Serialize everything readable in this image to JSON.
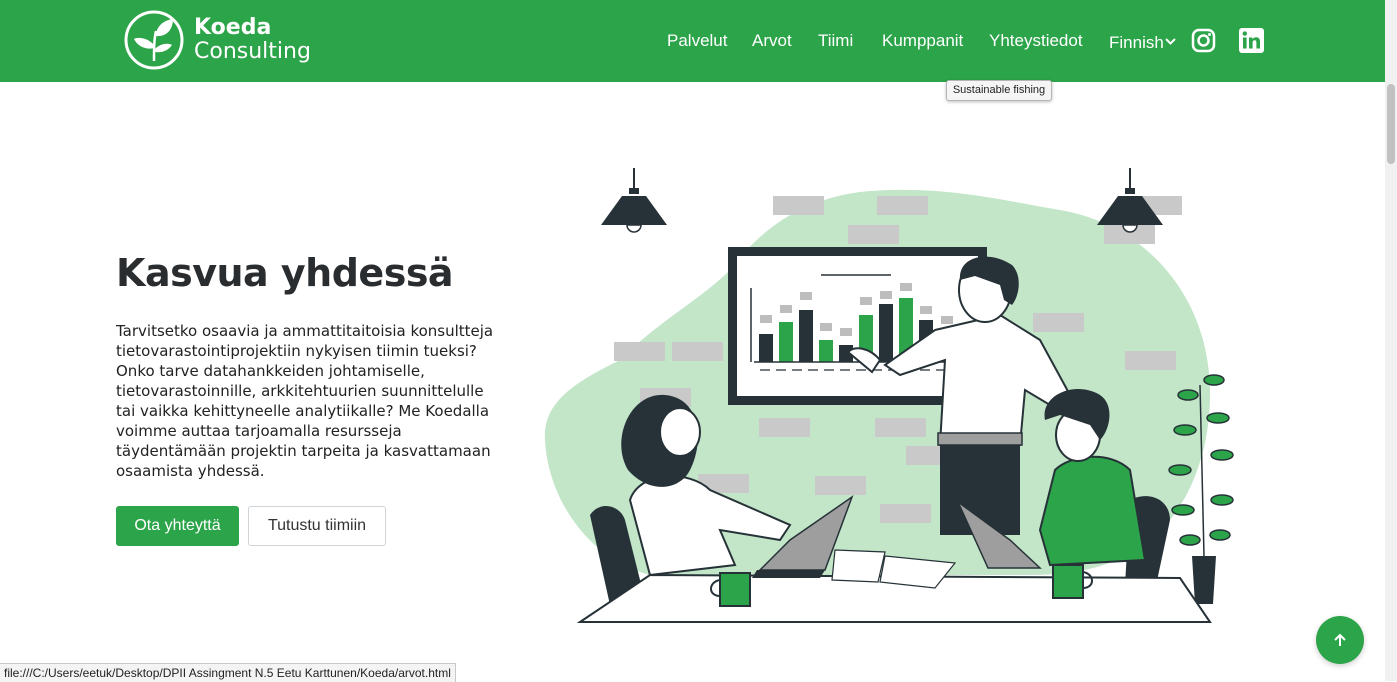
{
  "brand": {
    "line1": "Koeda",
    "line2": "Consulting",
    "logo_icon": "leaf-logo-icon"
  },
  "nav": {
    "items": [
      "Palvelut",
      "Arvot",
      "Tiimi",
      "Kumppanit",
      "Yhteystiedot"
    ],
    "language": "Finnish",
    "social_icons": [
      "instagram-icon",
      "linkedin-icon"
    ]
  },
  "tooltip": "Sustainable fishing",
  "hero": {
    "title": "Kasvua yhdessä",
    "text": "Tarvitsetko osaavia ja ammattitaitoisia konsultteja tietovarastointiprojektiin nykyisen tiimin tueksi? Onko tarve datahankkeiden johtamiselle, tietovarastoinnille, arkkitehtuurien suunnittelulle tai vaikka kehittyneelle analytiikalle? Me Koedalla voimme auttaa tarjoamalla resursseja täydentämään projektin tarpeita ja kasvattamaan osaamista yhdessä.",
    "primary_button": "Ota yhteyttä",
    "secondary_button": "Tutustu tiimiin"
  },
  "status_url": "file:///C:/Users/eetuk/Desktop/DPII Assingment N.5 Eetu Karttunen/Koeda/arvot.html",
  "colors": {
    "brand_green": "#2ca449",
    "dark": "#263238",
    "light_green": "#c3e5c8",
    "white": "#ffffff"
  }
}
